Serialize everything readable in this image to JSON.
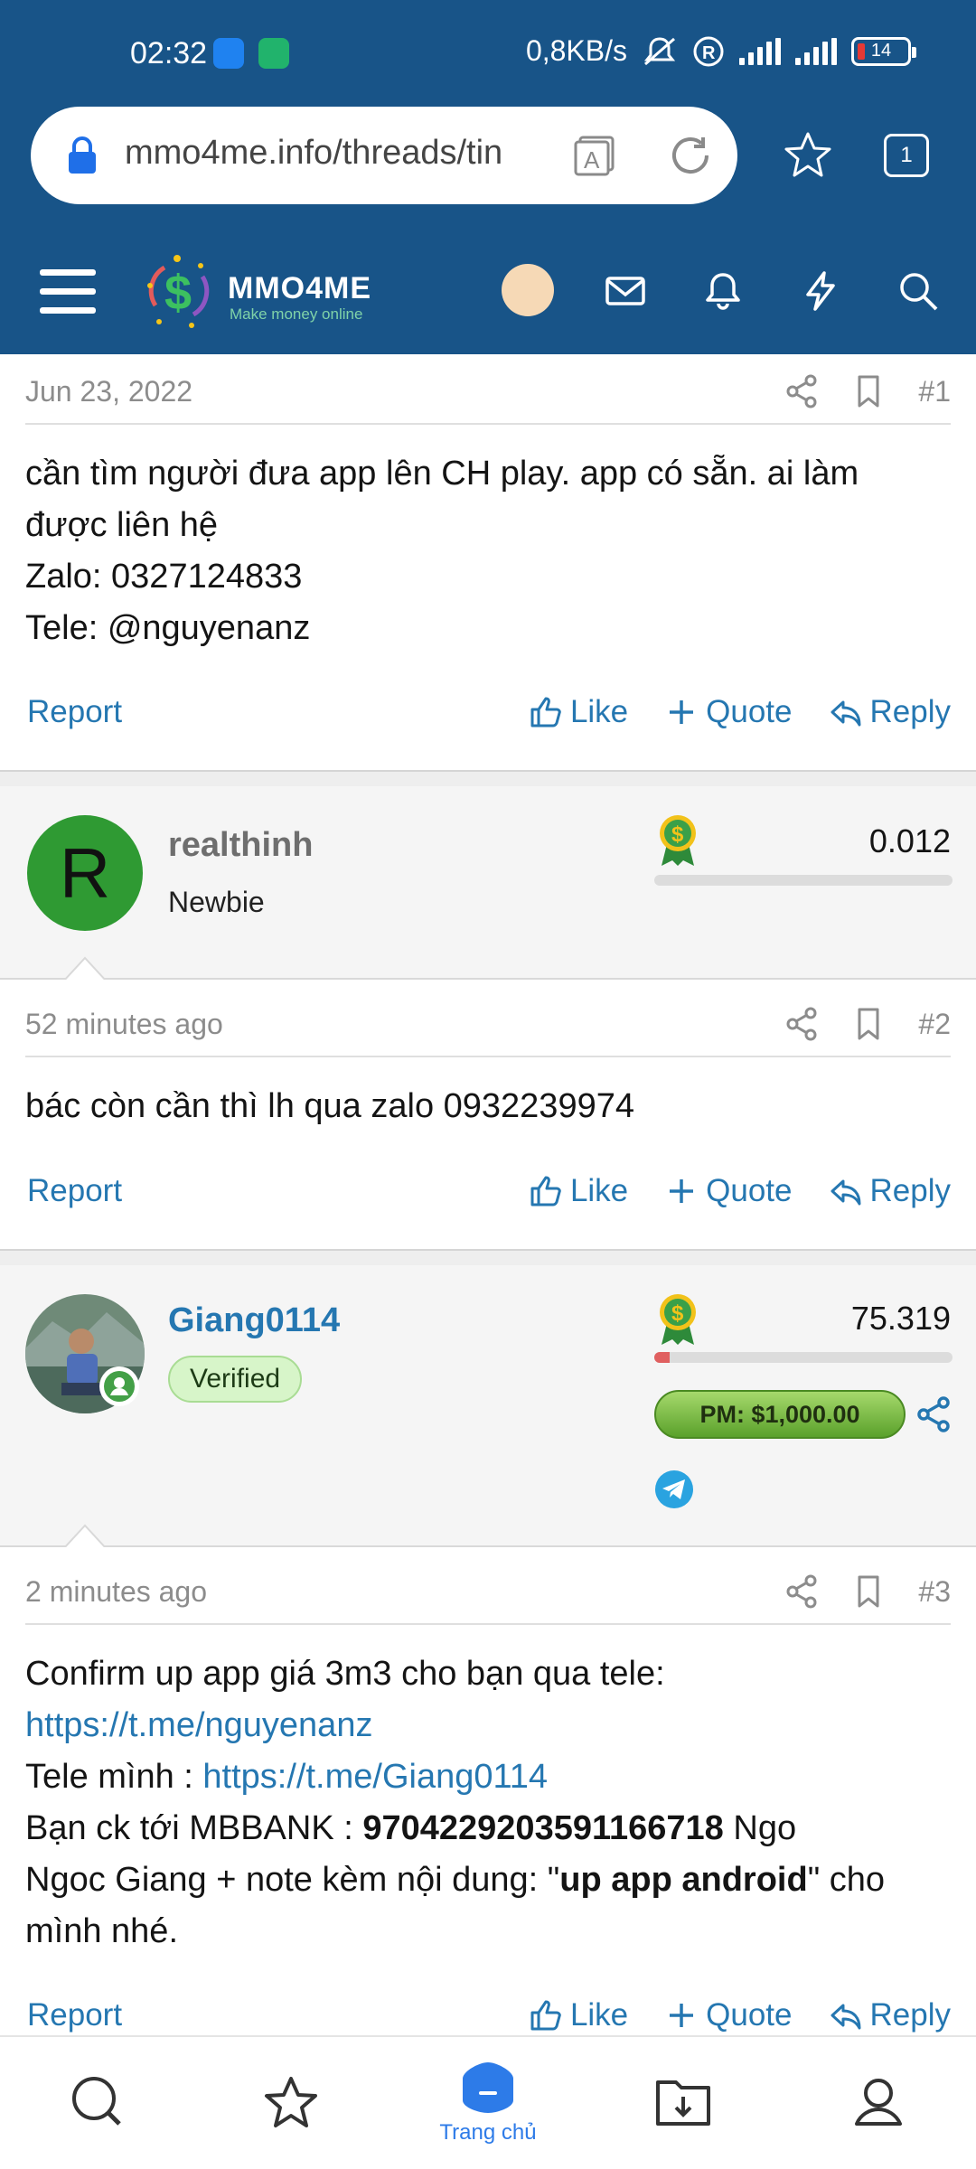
{
  "status_bar": {
    "time": "02:32",
    "network_speed": "0,8KB/s",
    "signal_type": "5G",
    "battery": "14"
  },
  "browser": {
    "url": "mmo4me.info/threads/tin",
    "tab_count": "1"
  },
  "site": {
    "logo_text": "MMO4ME",
    "logo_tagline": "Make money online"
  },
  "posts": [
    {
      "date": "Jun 23, 2022",
      "number": "#1",
      "body_lines": [
        "cần tìm người đưa app lên CH play. app có sẵn. ai làm",
        "được liên hệ",
        "Zalo: 0327124833",
        "Tele: @nguyenanz"
      ]
    },
    {
      "date": "52 minutes ago",
      "number": "#2",
      "body_lines": [
        "bác còn cần thì lh qua zalo 0932239974"
      ]
    },
    {
      "date": "2 minutes ago",
      "number": "#3",
      "body": {
        "line1": "Confirm up app giá 3m3 cho bạn qua tele:",
        "link1": "https://t.me/nguyenanz",
        "line3_prefix": "Tele mình : ",
        "link2": "https://t.me/Giang0114",
        "line4_prefix": "Bạn ck tới MBBANK : ",
        "account": "9704229203591166718",
        "line4_suffix": " Ngo",
        "line5_prefix": "Ngoc Giang + note kèm nội dung: \"",
        "note": "up app android",
        "line5_suffix": "\" cho",
        "line6": "mình nhé."
      }
    }
  ],
  "actions": {
    "report": "Report",
    "like": "Like",
    "quote": "Quote",
    "reply": "Reply"
  },
  "users": [
    {
      "avatar_letter": "R",
      "name": "realthinh",
      "title": "Newbie",
      "score": "0.012",
      "score_fraction": 0
    },
    {
      "name": "Giang0114",
      "badge": "Verified",
      "score": "75.319",
      "score_fraction": 0.05,
      "pm_label": "PM: $1,000.00"
    }
  ],
  "bottom_nav": {
    "home_label": "Trang chủ"
  },
  "colors": {
    "brand": "#185488",
    "link": "#2577b1",
    "accent": "#2d7be8"
  }
}
